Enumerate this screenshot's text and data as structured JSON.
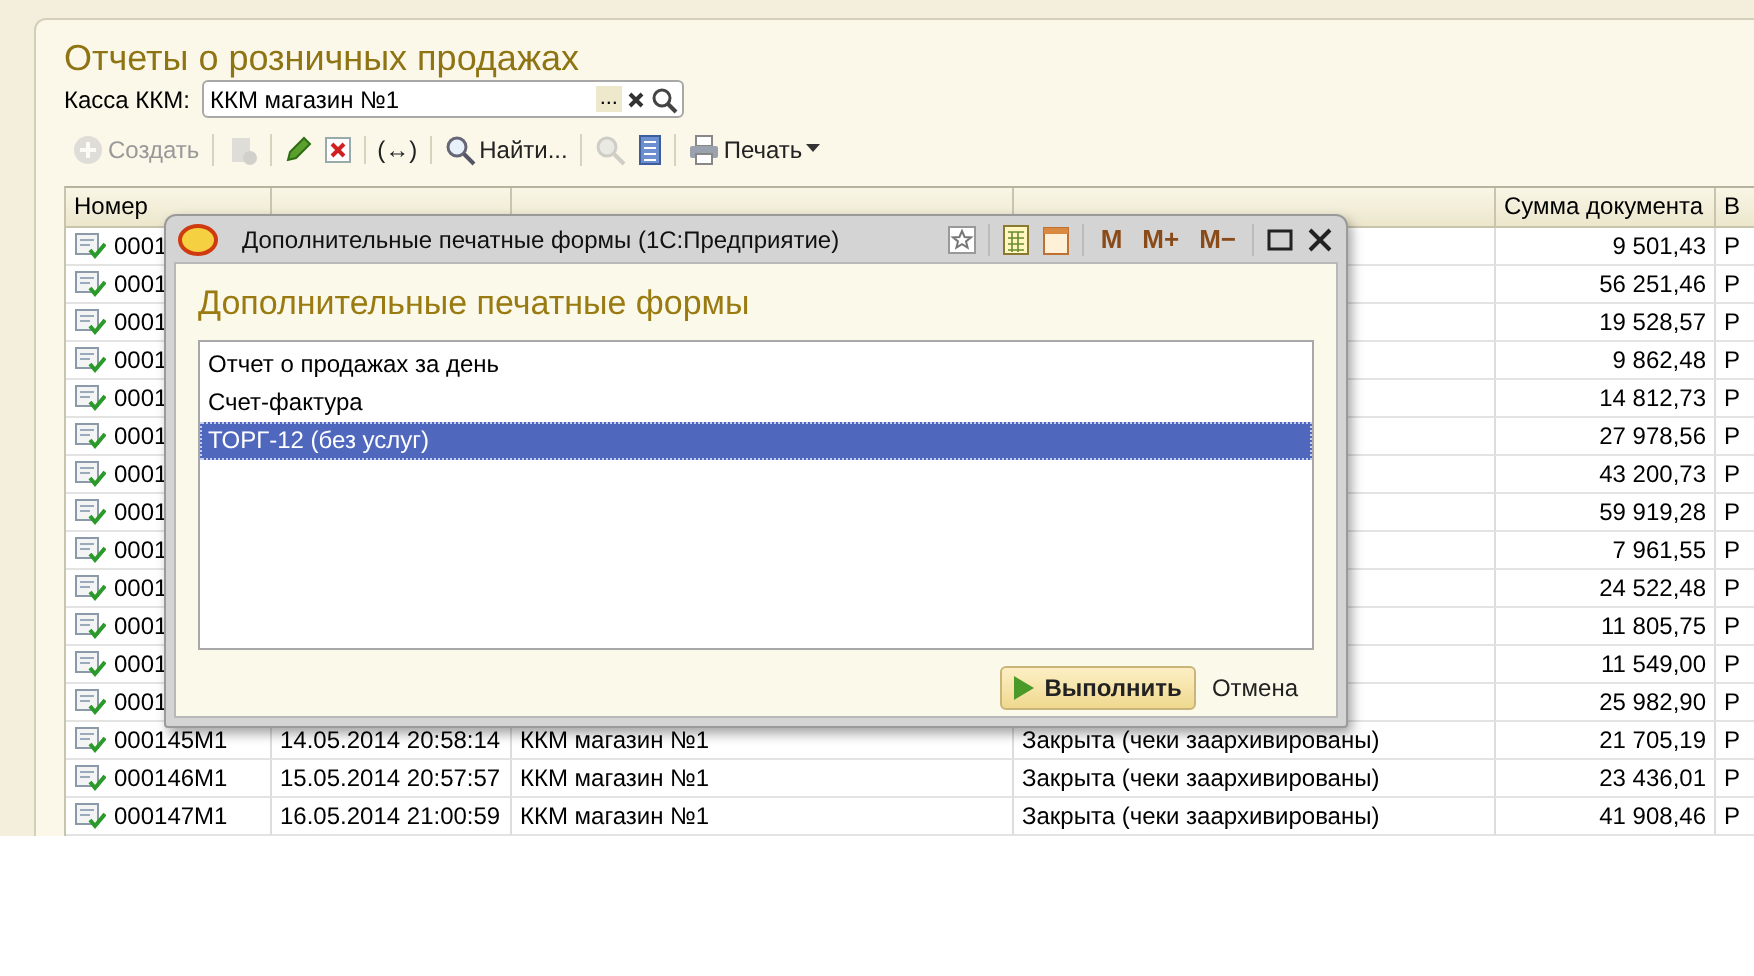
{
  "form": {
    "title": "Отчеты о розничных продажах",
    "filter": {
      "label": "Касса ККМ:",
      "value": "ККМ магазин №1",
      "choose_button": "..."
    },
    "toolbar": [
      [
        {
          "kind": "create",
          "label": "Создать",
          "disabled": true
        }
      ],
      [
        {
          "kind": "copy",
          "disabled": true
        }
      ],
      [
        {
          "kind": "edit",
          "disabled": false
        },
        {
          "kind": "delete",
          "disabled": false
        }
      ],
      [
        {
          "kind": "text",
          "label": "(↔)",
          "disabled": false
        }
      ],
      [
        {
          "kind": "find",
          "label": "Найти...",
          "disabled": false
        }
      ],
      [
        {
          "kind": "clear-search",
          "disabled": true
        },
        {
          "kind": "list",
          "disabled": false
        }
      ],
      [
        {
          "kind": "print",
          "label": "Печать",
          "disabled": false
        }
      ]
    ],
    "table": {
      "columns": [
        "Номер",
        "",
        "",
        "",
        "Сумма документа",
        "В"
      ],
      "rows": [
        {
          "number": "0001",
          "sum": "9 501,43",
          "column_6": "Р"
        },
        {
          "number": "0001",
          "sum": "56 251,46",
          "column_6": "Р"
        },
        {
          "number": "0001",
          "sum": "19 528,57",
          "column_6": "Р"
        },
        {
          "number": "0001",
          "sum": "9 862,48",
          "column_6": "Р"
        },
        {
          "number": "0001",
          "sum": "14 812,73",
          "column_6": "Р"
        },
        {
          "number": "0001",
          "sum": "27 978,56",
          "column_6": "Р"
        },
        {
          "number": "0001",
          "sum": "43 200,73",
          "column_6": "Р"
        },
        {
          "number": "0001",
          "sum": "59 919,28",
          "column_6": "Р"
        },
        {
          "number": "0001",
          "sum": "7 961,55",
          "column_6": "Р"
        },
        {
          "number": "0001",
          "sum": "24 522,48",
          "column_6": "Р"
        },
        {
          "number": "0001",
          "sum": "11 805,75",
          "column_6": "Р"
        },
        {
          "number": "0001",
          "sum": "11 549,00",
          "column_6": "Р"
        },
        {
          "number": "0001",
          "sum": "25 982,90",
          "column_6": "Р"
        },
        {
          "number": "000145M1",
          "date": "14.05.2014 20:58:14",
          "register": "ККМ магазин №1",
          "status": "Закрыта (чеки заархивированы)",
          "sum": "21 705,19",
          "column_6": "Р"
        },
        {
          "number": "000146M1",
          "date": "15.05.2014 20:57:57",
          "register": "ККМ магазин №1",
          "status": "Закрыта (чеки заархивированы)",
          "sum": "23 436,01",
          "column_6": "Р"
        },
        {
          "number": "000147M1",
          "date": "16.05.2014 21:00:59",
          "register": "ККМ магазин №1",
          "status": "Закрыта (чеки заархивированы)",
          "sum": "41 908,46",
          "column_6": "Р"
        }
      ]
    }
  },
  "dialog": {
    "window_title": "Дополнительные печатные формы  (1С:Предприятие)",
    "title_buttons": [
      "M",
      "M+",
      "M−"
    ],
    "heading": "Дополнительные печатные формы",
    "items": [
      {
        "label": "Отчет о продажах за день",
        "selected": false
      },
      {
        "label": "Счет-фактура",
        "selected": false
      },
      {
        "label": "ТОРГ-12 (без услуг)",
        "selected": true
      }
    ],
    "run_button": "Выполнить",
    "cancel_link": "Отмена"
  }
}
